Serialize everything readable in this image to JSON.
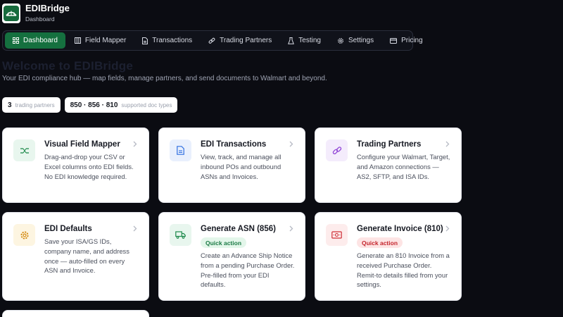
{
  "app": {
    "name": "EDIBridge",
    "subtitle": "Dashboard"
  },
  "nav": [
    {
      "label": "Dashboard",
      "icon": "grid-icon",
      "active": true
    },
    {
      "label": "Field Mapper",
      "icon": "columns-icon"
    },
    {
      "label": "Transactions",
      "icon": "document-icon"
    },
    {
      "label": "Trading Partners",
      "icon": "link-icon"
    },
    {
      "label": "Testing",
      "icon": "flask-icon"
    },
    {
      "label": "Settings",
      "icon": "gear-icon"
    },
    {
      "label": "Pricing",
      "icon": "card-icon"
    }
  ],
  "page": {
    "title": "Welcome to EDIBridge",
    "description": "Your EDI compliance hub — map fields, manage partners, and send documents to Walmart and beyond."
  },
  "stats": [
    {
      "value": "3",
      "label": "trading partners"
    },
    {
      "value": "850 · 856 · 810",
      "label": "supported doc types"
    }
  ],
  "cards": [
    {
      "title": "Visual Field Mapper",
      "description": "Drag-and-drop your CSV or Excel columns onto EDI fields. No EDI knowledge required.",
      "icon": "mapper-icon",
      "badge": ""
    },
    {
      "title": "EDI Transactions",
      "description": "View, track, and manage all inbound POs and outbound ASNs and Invoices.",
      "icon": "document-icon",
      "badge": ""
    },
    {
      "title": "Trading Partners",
      "description": "Configure your Walmart, Target, and Amazon connections — AS2, SFTP, and ISA IDs.",
      "icon": "link-icon",
      "badge": ""
    },
    {
      "title": "EDI Defaults",
      "description": "Save your ISA/GS IDs, company name, and address once — auto-filled on every ASN and Invoice.",
      "icon": "gear-icon",
      "badge": ""
    },
    {
      "title": "Generate ASN (856)",
      "description": "Create an Advance Ship Notice from a pending Purchase Order. Pre-filled from your EDI defaults.",
      "icon": "truck-icon",
      "badge": "Quick action"
    },
    {
      "title": "Generate Invoice (810)",
      "description": "Generate an 810 Invoice from a received Purchase Order. Remit-to details filled from your settings.",
      "icon": "cash-icon",
      "badge": "Quick action"
    }
  ],
  "colors": {
    "accent": "#15703f",
    "background": "#0b0c12",
    "card": "#ffffff",
    "quick_action_green": "#1b7a45",
    "quick_action_red": "#c4242c"
  }
}
